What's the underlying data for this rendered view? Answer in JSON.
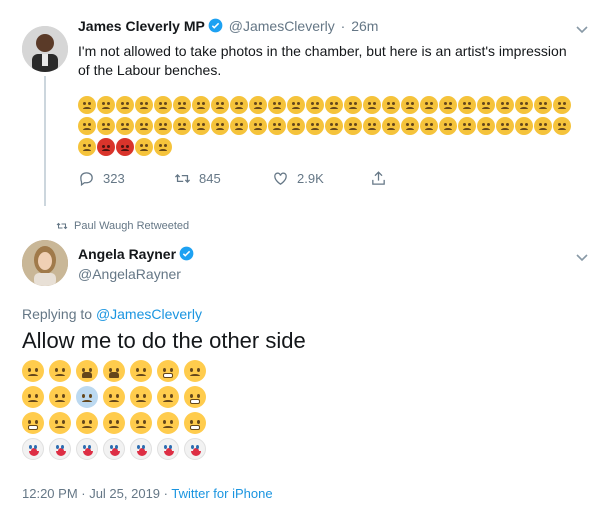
{
  "tweet1": {
    "author_name": "James Cleverly MP",
    "handle": "@JamesCleverly",
    "separator": "·",
    "time_ago": "26m",
    "text": "I'm not allowed to take photos in the chamber, but here is an artist's impression of the Labour benches.",
    "emoji_rows": [
      [
        "sad",
        "sad",
        "sad",
        "sad",
        "sad",
        "sad",
        "sad",
        "sad",
        "sad",
        "sad",
        "sad",
        "sad",
        "sad",
        "sad",
        "sad",
        "sad",
        "sad",
        "sad",
        "sad",
        "sad",
        "sad",
        "sad",
        "sad",
        "sad",
        "sad",
        "sad"
      ],
      [
        "sad",
        "sad",
        "sad",
        "sad",
        "sad",
        "sad",
        "sad",
        "sad",
        "sad",
        "sad",
        "sad",
        "sad",
        "sad",
        "sad",
        "sad",
        "sad",
        "sad",
        "sad",
        "sad",
        "sad",
        "sad",
        "sad",
        "sad",
        "sad",
        "sad",
        "sad"
      ],
      [
        "sad",
        "angry",
        "angry",
        "sad",
        "sad"
      ]
    ],
    "actions": {
      "replies": "323",
      "retweets": "845",
      "likes": "2.9K"
    }
  },
  "retweet_label": "Paul Waugh Retweeted",
  "tweet2": {
    "author_name": "Angela Rayner",
    "handle": "@AngelaRayner",
    "replying_prefix": "Replying to",
    "replying_to": "@JamesCleverly",
    "text": "Allow me to do the other side",
    "emoji_rows": [
      [
        "flushed",
        "sad",
        "cry",
        "cry",
        "weary",
        "grin",
        "upside"
      ],
      [
        "zany",
        "sad",
        "scream",
        "sad",
        "sad",
        "sad",
        "grin"
      ],
      [
        "grin",
        "sad",
        "neutral",
        "sad",
        "sad",
        "neutral",
        "grin"
      ],
      [
        "clown",
        "clown",
        "clown",
        "clown",
        "clown",
        "clown",
        "clown"
      ]
    ],
    "timestamp": "12:20 PM · Jul 25, 2019",
    "timestamp_sep": "·",
    "source": "Twitter for iPhone"
  },
  "icons": {
    "verified": "verified-badge-icon",
    "chevron": "chevron-down-icon",
    "reply": "reply-icon",
    "retweet": "retweet-icon",
    "like": "heart-icon",
    "share": "share-icon"
  },
  "colors": {
    "verified_blue": "#1da1f2",
    "link_blue": "#1b95e0",
    "muted": "#657786",
    "text": "#14171a"
  }
}
